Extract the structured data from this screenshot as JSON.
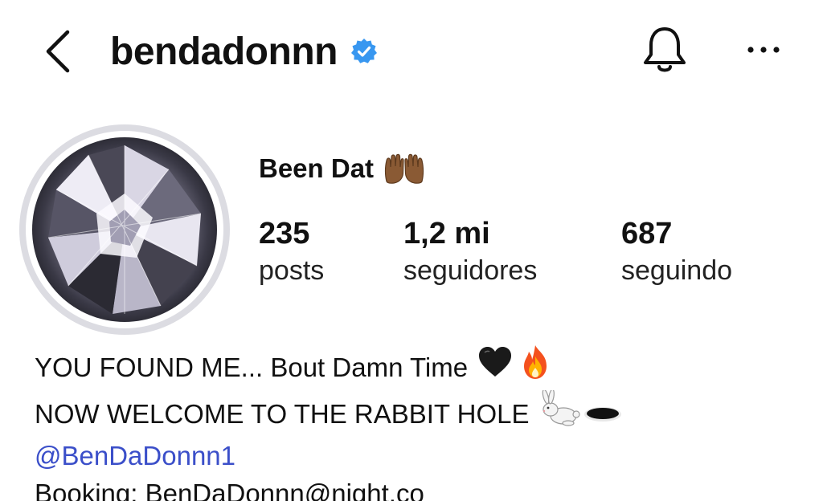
{
  "header": {
    "username": "bendadonnn",
    "verified": true
  },
  "profile": {
    "display_name": "Been Dat",
    "display_name_emoji": "raised-hands-emoji",
    "stats": {
      "posts": {
        "value": "235",
        "label": "posts"
      },
      "followers": {
        "value": "1,2 mi",
        "label": "seguidores"
      },
      "following": {
        "value": "687",
        "label": "seguindo"
      }
    }
  },
  "bio": {
    "line1": "YOU FOUND ME... Bout Damn Time",
    "line1_emojis": [
      "black-heart-emoji",
      "fire-emoji"
    ],
    "line2": "NOW WELCOME TO THE RABBIT HOLE",
    "line2_emojis": [
      "rabbit-emoji",
      "hole-emoji"
    ],
    "mention": "@BenDaDonnn1",
    "booking": "Booking: BenDaDonnn@night.co"
  },
  "colors": {
    "verified_blue": "#3897f0",
    "mention_blue": "#3b4fc9",
    "text": "#111111",
    "avatar_ring": "#dcdce2"
  }
}
